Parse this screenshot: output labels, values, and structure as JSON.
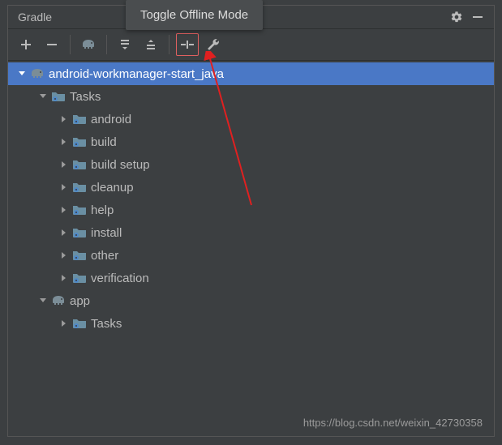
{
  "header": {
    "title": "Gradle"
  },
  "tooltip": "Toggle Offline Mode",
  "toolbar": {
    "buttons": [
      {
        "name": "add-button",
        "icon": "plus"
      },
      {
        "name": "remove-button",
        "icon": "minus"
      },
      {
        "name": "sep"
      },
      {
        "name": "reload-button",
        "icon": "elephant"
      },
      {
        "name": "sep"
      },
      {
        "name": "expand-all-button",
        "icon": "stack-down"
      },
      {
        "name": "collapse-all-button",
        "icon": "stack-up"
      },
      {
        "name": "sep"
      },
      {
        "name": "toggle-offline-button",
        "icon": "offline",
        "highlight": true
      },
      {
        "name": "wrench-button",
        "icon": "wrench"
      }
    ]
  },
  "tree": [
    {
      "depth": 0,
      "expanded": true,
      "selected": true,
      "icon": "elephant",
      "label": "android-workmanager-start_java"
    },
    {
      "depth": 1,
      "expanded": true,
      "icon": "folder",
      "label": "Tasks"
    },
    {
      "depth": 2,
      "expanded": false,
      "icon": "folder",
      "label": "android"
    },
    {
      "depth": 2,
      "expanded": false,
      "icon": "folder",
      "label": "build"
    },
    {
      "depth": 2,
      "expanded": false,
      "icon": "folder",
      "label": "build setup"
    },
    {
      "depth": 2,
      "expanded": false,
      "icon": "folder",
      "label": "cleanup"
    },
    {
      "depth": 2,
      "expanded": false,
      "icon": "folder",
      "label": "help"
    },
    {
      "depth": 2,
      "expanded": false,
      "icon": "folder",
      "label": "install"
    },
    {
      "depth": 2,
      "expanded": false,
      "icon": "folder",
      "label": "other"
    },
    {
      "depth": 2,
      "expanded": false,
      "icon": "folder",
      "label": "verification"
    },
    {
      "depth": 1,
      "expanded": true,
      "icon": "elephant",
      "label": "app"
    },
    {
      "depth": 2,
      "expanded": false,
      "icon": "folder",
      "label": "Tasks"
    }
  ],
  "watermark": "https://blog.csdn.net/weixin_42730358",
  "colors": {
    "selection": "#4A78C6",
    "highlight_border": "#e06060"
  }
}
